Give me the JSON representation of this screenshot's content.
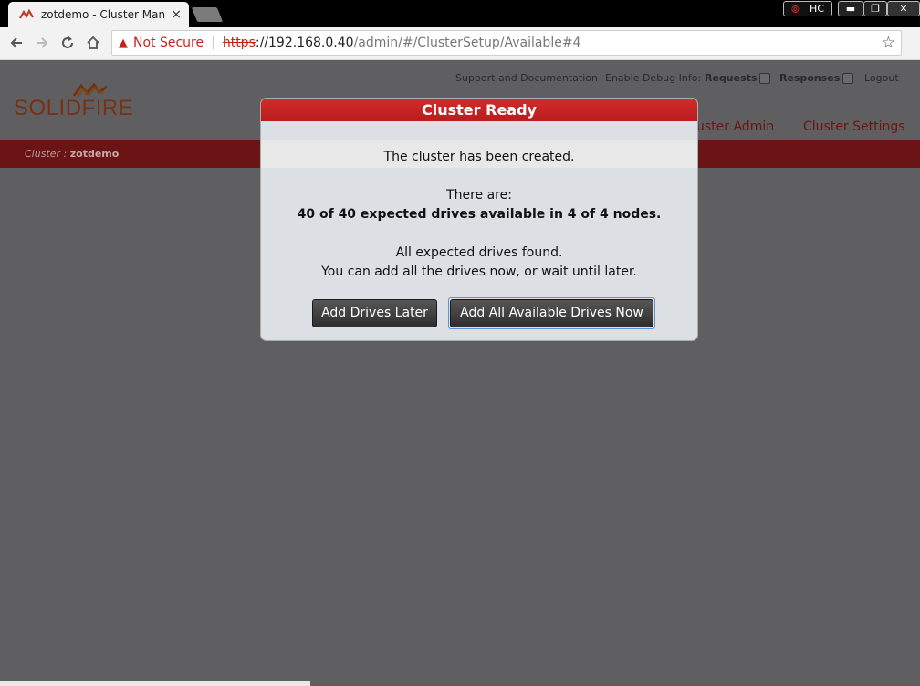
{
  "browser": {
    "tab_title": "zotdemo - Cluster Man",
    "tab_close": "×",
    "hc_label": "HC",
    "url_security": "Not Secure",
    "url_scheme": "https",
    "url_host": "://192.168.0.40",
    "url_path": "/admin/#/ClusterSetup/Available#4"
  },
  "header": {
    "logo_solid": "SOLID",
    "logo_fire": "FIRE",
    "support_link": "Support and Documentation",
    "debug_label": "Enable Debug Info:",
    "requests_label": "Requests",
    "responses_label": "Responses",
    "logout_label": "Logout",
    "menu": [
      {
        "label": "uster Admin"
      },
      {
        "label": "Cluster Settings"
      }
    ]
  },
  "cluster_bar": {
    "prefix": "Cluster :",
    "name": "zotdemo"
  },
  "modal": {
    "title": "Cluster Ready",
    "created_text": "The cluster has been created.",
    "there_are": "There are:",
    "drives_summary": "40 of 40 expected drives available in 4 of 4 nodes.",
    "found_text": "All expected drives found.",
    "advice_text": "You can add all the drives now, or wait until later.",
    "later_button": "Add Drives Later",
    "now_button": "Add All Available Drives Now"
  },
  "colors": {
    "accent_red": "#c62828",
    "bar_red": "#6b1416",
    "overlay_gray": "#5f5f62"
  }
}
